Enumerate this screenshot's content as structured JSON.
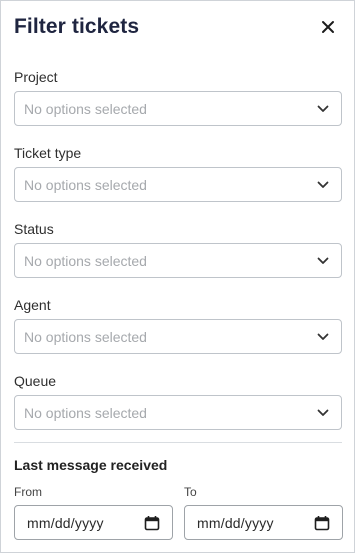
{
  "header": {
    "title": "Filter tickets"
  },
  "icons": {
    "close": "close-icon",
    "dropdown": "chevron-down-icon",
    "calendar": "calendar-icon"
  },
  "filters": [
    {
      "label": "Project",
      "placeholder": "No options selected"
    },
    {
      "label": "Ticket type",
      "placeholder": "No options selected"
    },
    {
      "label": "Status",
      "placeholder": "No options selected"
    },
    {
      "label": "Agent",
      "placeholder": "No options selected"
    },
    {
      "label": "Queue",
      "placeholder": "No options selected"
    }
  ],
  "last_message": {
    "title": "Last message received",
    "from_label": "From",
    "to_label": "To",
    "from_value": "mm/dd/yyyy",
    "to_value": "mm/dd/yyyy"
  },
  "colors": {
    "title": "#1f2540",
    "placeholder": "#a6a9ad",
    "border": "#bfc4ca"
  }
}
